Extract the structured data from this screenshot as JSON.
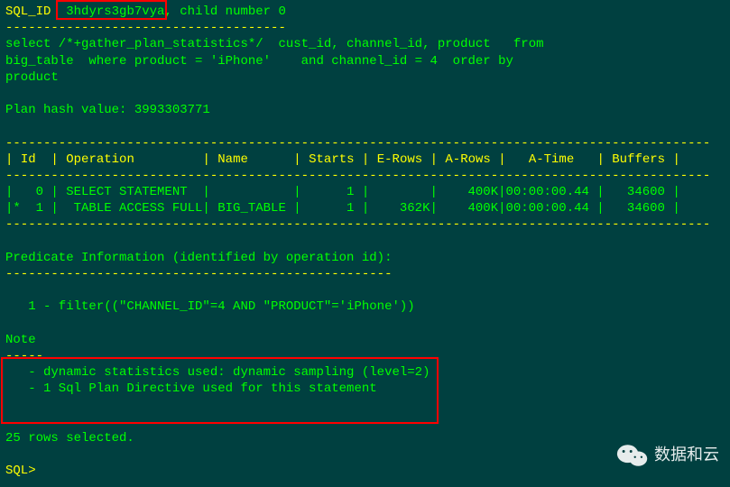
{
  "header": {
    "sql_id_label": "SQL_ID",
    "sql_id_value": "3hdyrs3gb7vya",
    "child_text": "child number 0"
  },
  "divider_short": "-------------------------------------",
  "query_text": "select /*+gather_plan_statistics*/  cust_id, channel_id, product   from\nbig_table  where product = 'iPhone'    and channel_id = 4  order by\nproduct",
  "plan_hash_label": "Plan hash value: 3993303771",
  "table_divider": "---------------------------------------------------------------------------------------------",
  "columns": [
    "Id",
    "Operation",
    "Name",
    "Starts",
    "E-Rows",
    "A-Rows",
    "A-Time",
    "Buffers"
  ],
  "plan_row_0": "|   0 | SELECT STATEMENT  |           |      1 |        |    400K|00:00:00.44 |   34600 |",
  "plan_row_1": "|*  1 |  TABLE ACCESS FULL| BIG_TABLE |      1 |    362K|    400K|00:00:00.44 |   34600 |",
  "pred_header": "Predicate Information (identified by operation id):",
  "pred_divider": "---------------------------------------------------",
  "pred_line": "   1 - filter((\"CHANNEL_ID\"=4 AND \"PRODUCT\"='iPhone'))",
  "note": {
    "title": "Note",
    "dash": "-----",
    "line1": "   - dynamic statistics used: dynamic sampling (level=2)",
    "line2": "   - 1 Sql Plan Directive used for this statement"
  },
  "rows_selected": "25 rows selected.",
  "prompt": "SQL>",
  "watermark_text": "数据和云",
  "chart_data": {
    "type": "table",
    "title": "Oracle SQL Execution Plan",
    "sql_id": "3hdyrs3gb7vya",
    "child_number": 0,
    "plan_hash_value": 3993303771,
    "columns": [
      "Id",
      "Operation",
      "Name",
      "Starts",
      "E-Rows",
      "A-Rows",
      "A-Time",
      "Buffers"
    ],
    "rows": [
      {
        "Id": 0,
        "Operation": "SELECT STATEMENT",
        "Name": "",
        "Starts": 1,
        "E-Rows": null,
        "A-Rows": "400K",
        "A-Time": "00:00:00.44",
        "Buffers": 34600
      },
      {
        "Id": 1,
        "Operation": "TABLE ACCESS FULL",
        "Name": "BIG_TABLE",
        "Starts": 1,
        "E-Rows": "362K",
        "A-Rows": "400K",
        "A-Time": "00:00:00.44",
        "Buffers": 34600,
        "filter": true
      }
    ],
    "predicate": "filter((\"CHANNEL_ID\"=4 AND \"PRODUCT\"='iPhone'))",
    "notes": [
      "dynamic statistics used: dynamic sampling (level=2)",
      "1 Sql Plan Directive used for this statement"
    ],
    "rows_selected": 25
  }
}
